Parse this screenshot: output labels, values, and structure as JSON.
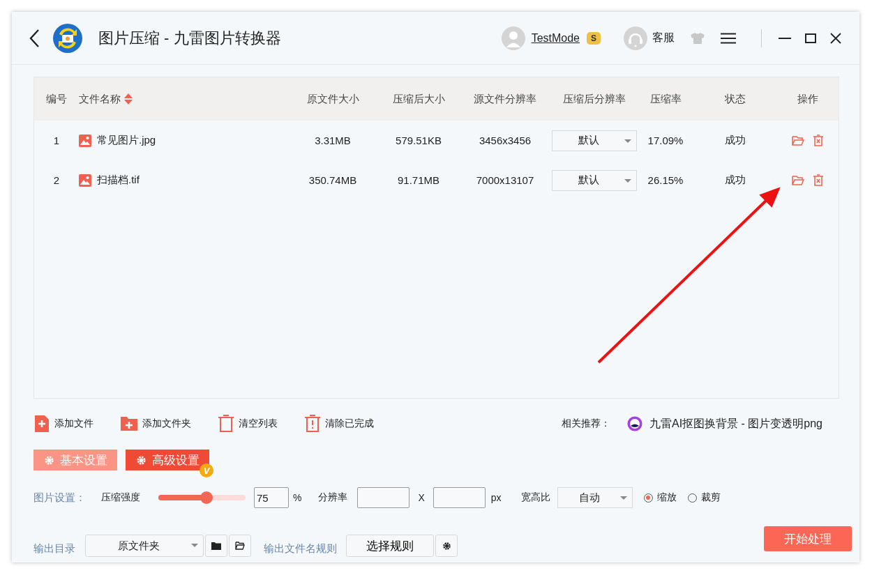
{
  "window": {
    "title": "图片压缩 - 九雷图片转换器"
  },
  "header": {
    "user": "TestMode",
    "user_badge": "S",
    "support": "客服"
  },
  "table": {
    "columns": [
      "编号",
      "文件名称",
      "原文件大小",
      "压缩后大小",
      "源文件分辨率",
      "压缩后分辨率",
      "压缩率",
      "状态",
      "操作"
    ],
    "rows": [
      {
        "index": "1",
        "name": "常见图片.jpg",
        "original_size": "3.31MB",
        "compressed_size": "579.51KB",
        "source_resolution": "3456x3456",
        "output_resolution": "默认",
        "ratio": "17.09%",
        "status": "成功"
      },
      {
        "index": "2",
        "name": "扫描档.tif",
        "original_size": "350.74MB",
        "compressed_size": "91.71MB",
        "source_resolution": "7000x13107",
        "output_resolution": "默认",
        "ratio": "26.15%",
        "status": "成功"
      }
    ]
  },
  "toolbar": [
    {
      "kind": "add-file",
      "label": "添加文件"
    },
    {
      "kind": "add-folder",
      "label": "添加文件夹"
    },
    {
      "kind": "clear",
      "label": "清空列表"
    },
    {
      "kind": "clear-done",
      "label": "清除已完成"
    }
  ],
  "recommendation": {
    "label": "相关推荐：",
    "link": "九雷AI抠图换背景 - 图片变透明png"
  },
  "settings_tabs": [
    {
      "label": "基本设置",
      "selected": false
    },
    {
      "label": "高级设置",
      "selected": true,
      "badge": "V"
    }
  ],
  "image_settings": {
    "label": "图片设置：",
    "strength_label": "压缩强度",
    "strength": {
      "level": 0.55
    },
    "strength_value": "75",
    "percent": "%",
    "resolution_label": "分辨率",
    "times": "X",
    "unit": "px",
    "aspect_label": "宽高比",
    "aspect_value": "自动",
    "modes": [
      {
        "label": "缩放",
        "selected": true
      },
      {
        "label": "裁剪",
        "selected": false
      }
    ]
  },
  "output": {
    "dir_label": "输出目录",
    "dir_value": "原文件夹",
    "rule_label": "输出文件名规则",
    "rule_button": "选择规则",
    "start_button": "开始处理"
  }
}
